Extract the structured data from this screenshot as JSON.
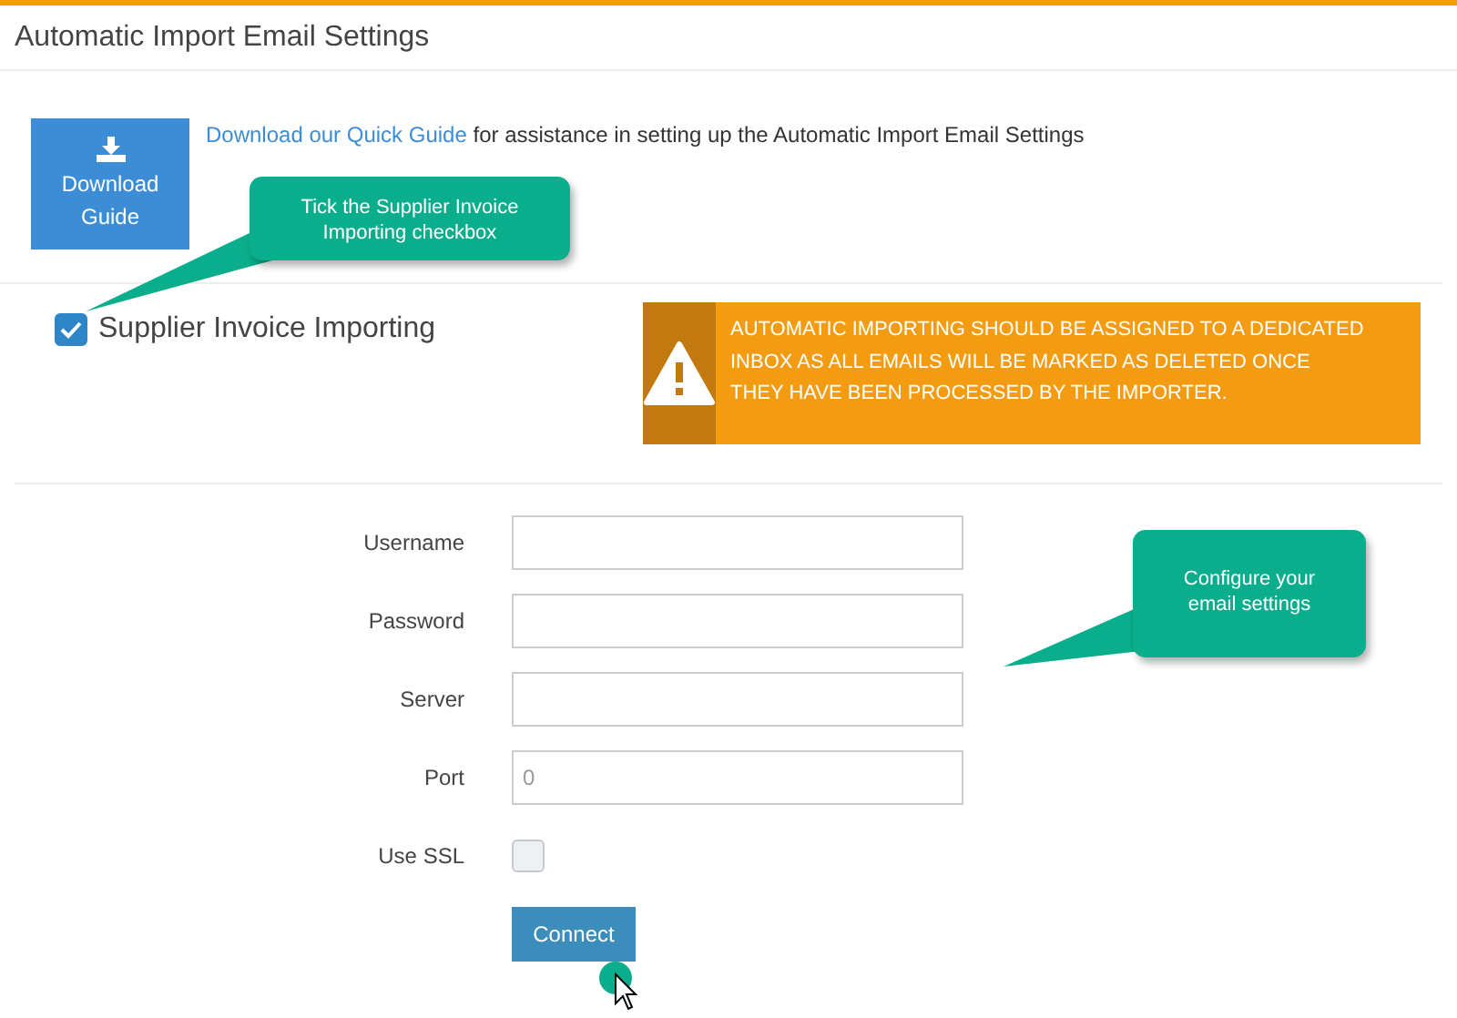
{
  "header": {
    "title": "Automatic Import Email Settings"
  },
  "guide": {
    "button": "Download Guide",
    "link": "Download our Quick Guide",
    "text": " for assistance in setting up the Automatic Import Email Settings"
  },
  "supplier_importing": {
    "label": "Supplier Invoice Importing",
    "checked": true
  },
  "alert": {
    "text": "AUTOMATIC IMPORTING SHOULD BE ASSIGNED TO A DEDICATED INBOX AS ALL EMAILS WILL BE MARKED AS DELETED ONCE THEY HAVE BEEN PROCESSED BY THE IMPORTER."
  },
  "form": [
    {
      "kind": "input",
      "label": "Username"
    },
    {
      "kind": "input",
      "label": "Password"
    },
    {
      "kind": "input",
      "label": "Server"
    },
    {
      "kind": "input",
      "label": "Port",
      "placeholder": "0"
    },
    {
      "kind": "checkbox",
      "label": "Use SSL",
      "checked": false
    }
  ],
  "connect_button": "Connect",
  "callouts": [
    {
      "text": "Tick the Supplier Invoice Importing checkbox"
    },
    {
      "text": "Configure your email settings"
    }
  ]
}
